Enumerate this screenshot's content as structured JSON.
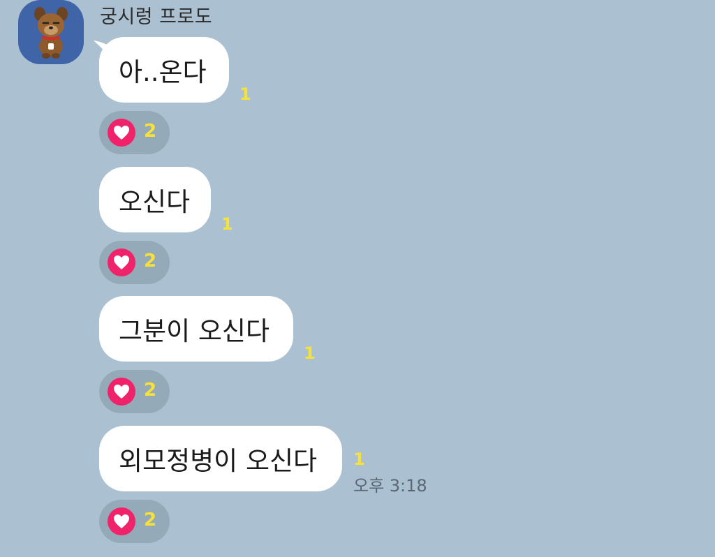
{
  "sender": {
    "name": "궁시렁 프로도"
  },
  "messages": [
    {
      "text": "아..온다",
      "unread": "1",
      "reaction_count": "2"
    },
    {
      "text": "오신다",
      "unread": "1",
      "reaction_count": "2"
    },
    {
      "text": "그분이 오신다",
      "unread": "1",
      "reaction_count": "2"
    },
    {
      "text": "외모정병이 오신다",
      "unread": "1",
      "reaction_count": "2"
    }
  ],
  "last_message_time": "오후 3:18",
  "reaction_icon": "heart-icon",
  "colors": {
    "background": "#abc1d1",
    "bubble": "#ffffff",
    "unread": "#f7e23a",
    "reaction_pill": "#95aab9",
    "heart_badge": "#f0226a",
    "avatar_bg": "#3f64a8"
  }
}
